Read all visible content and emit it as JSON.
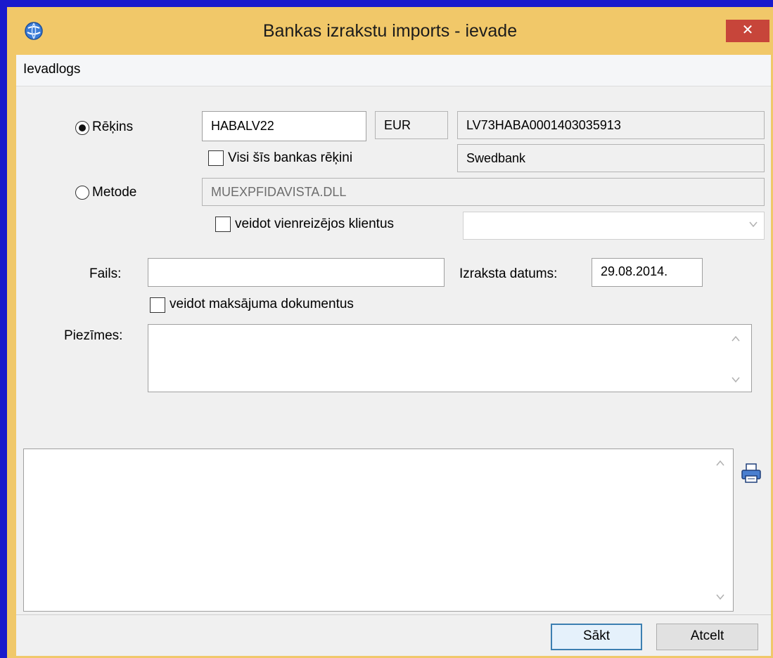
{
  "window": {
    "title": "Bankas izrakstu imports - ievade",
    "close_label": "✕"
  },
  "menu": {
    "items": [
      "Ievadlogs"
    ]
  },
  "form": {
    "account_radio_label": "Rēķins",
    "account_radio_checked": true,
    "bank_code": "HABALV22",
    "currency": "EUR",
    "iban": "LV73HABA0001403035913",
    "all_accounts_label": "Visi šīs bankas rēķini",
    "all_accounts_checked": false,
    "bank_name": "Swedbank",
    "method_radio_label": "Metode",
    "method_radio_checked": false,
    "method_value": "MUEXPFIDAVISTA.DLL",
    "one_time_clients_label": "veidot vienreizējos klientus",
    "one_time_clients_checked": false,
    "one_time_clients_select": "",
    "file_label": "Fails:",
    "file_value": "",
    "statement_date_label": "Izraksta datums:",
    "statement_date_value": "29.08.2014.",
    "create_payment_docs_label": "veidot maksājuma dokumentus",
    "create_payment_docs_checked": false,
    "notes_label": "Piezīmes:",
    "notes_value": ""
  },
  "output": {
    "text": ""
  },
  "icons": {
    "app": "app-globe-icon",
    "close": "close-icon",
    "printer": "printer-icon",
    "scroll_up": "chevron-up-icon",
    "scroll_down": "chevron-down-icon"
  },
  "buttons": {
    "start": "Sākt",
    "cancel": "Atcelt"
  },
  "colors": {
    "titlebar": "#f1c869",
    "close": "#c7453a",
    "desktop": "#1a1acc",
    "default_button_border": "#3c7fb1"
  }
}
